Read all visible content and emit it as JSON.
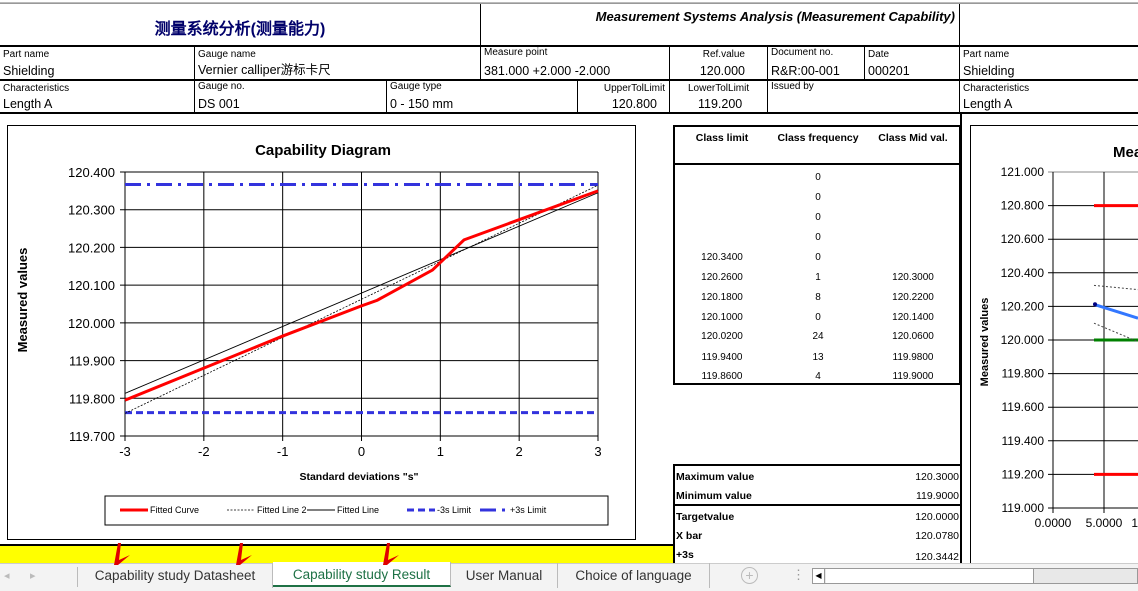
{
  "header": {
    "title_cn": "测量系统分析(测量能力)",
    "title_en": "Measurement Systems Analysis (Measurement Capability)"
  },
  "fields": {
    "part_name": {
      "label": "Part name",
      "value": "Shielding"
    },
    "gauge_name": {
      "label": "Gauge name",
      "value": "Vernier calliper游标卡尺"
    },
    "measure_point": {
      "label": "Measure point",
      "value": "381.000 +2.000 -2.000"
    },
    "ref_value": {
      "label": "Ref.value",
      "value": "120.000"
    },
    "document_no": {
      "label": "Document no.",
      "value": "R&R:00-001"
    },
    "date": {
      "label": "Date",
      "value": "000201"
    },
    "characteristics": {
      "label": "Characteristics",
      "value": "Length A"
    },
    "gauge_no": {
      "label": "Gauge no.",
      "value": "DS 001"
    },
    "gauge_type": {
      "label": "Gauge type",
      "value": "0 - 150 mm"
    },
    "upper_tol": {
      "label": "UpperTolLimit",
      "value": "120.800"
    },
    "lower_tol": {
      "label": "LowerTolLimit",
      "value": "119.200"
    },
    "issued_by": {
      "label": "Issued by",
      "value": ""
    }
  },
  "class_table": {
    "headers": [
      "Class limit",
      "Class frequency",
      "Class Mid val."
    ],
    "rows": [
      [
        "",
        "0",
        ""
      ],
      [
        "",
        "0",
        ""
      ],
      [
        "",
        "0",
        ""
      ],
      [
        "",
        "0",
        ""
      ],
      [
        "120.3400",
        "0",
        ""
      ],
      [
        "120.2600",
        "1",
        "120.3000"
      ],
      [
        "120.1800",
        "8",
        "120.2200"
      ],
      [
        "120.1000",
        "0",
        "120.1400"
      ],
      [
        "120.0200",
        "24",
        "120.0600"
      ],
      [
        "119.9400",
        "13",
        "119.9800"
      ],
      [
        "119.8600",
        "4",
        "119.9000"
      ]
    ]
  },
  "stats": [
    {
      "label": "Maximum value",
      "value": "120.3000"
    },
    {
      "label": "Minimum value",
      "value": "119.9000"
    },
    {
      "label": "Targetvalue",
      "value": "120.0000"
    },
    {
      "label": "X bar",
      "value": "120.0780"
    },
    {
      "label": "+3s",
      "value": "120.3442"
    }
  ],
  "chart_data": [
    {
      "type": "line",
      "title": "Capability Diagram",
      "xlabel": "Standard deviations \"s\"",
      "ylabel": "Measured values",
      "xlim": [
        -3,
        3
      ],
      "ylim": [
        119.7,
        120.4
      ],
      "xticks": [
        "-3",
        "-2",
        "-1",
        "0",
        "1",
        "2",
        "3"
      ],
      "yticks": [
        "120.400",
        "120.300",
        "120.200",
        "120.100",
        "120.000",
        "119.900",
        "119.800",
        "119.700"
      ],
      "legend_position": "bottom",
      "series": [
        {
          "name": "Fitted Curve",
          "color": "#ff0000",
          "points": [
            [
              -3,
              119.795
            ],
            [
              -1,
              119.965
            ],
            [
              0,
              120.045
            ],
            [
              0.2,
              120.06
            ],
            [
              0.9,
              120.14
            ],
            [
              1.3,
              120.22
            ],
            [
              3,
              120.35
            ]
          ]
        },
        {
          "name": "Fitted Line 2",
          "color": "#000000",
          "points": [
            [
              -3,
              119.76
            ],
            [
              3,
              120.365
            ]
          ]
        },
        {
          "name": "Fitted Line",
          "color": "#000000",
          "points": [
            [
              -3,
              119.813
            ],
            [
              3,
              120.345
            ]
          ]
        },
        {
          "name": "-3s Limit",
          "color": "#3333dd",
          "points": [
            [
              -3,
              119.762
            ],
            [
              3,
              119.762
            ]
          ]
        },
        {
          "name": "+3s Limit",
          "color": "#3333dd",
          "points": [
            [
              -3,
              120.367
            ],
            [
              3,
              120.367
            ]
          ]
        }
      ]
    },
    {
      "type": "line",
      "title": "Mea",
      "ylabel": "Measured values",
      "ylim": [
        119.0,
        121.0
      ],
      "yticks": [
        "121.000",
        "120.800",
        "120.600",
        "120.400",
        "120.200",
        "120.000",
        "119.800",
        "119.600",
        "119.400",
        "119.200",
        "119.000"
      ],
      "xticks": [
        "0.0000",
        "5.0000"
      ]
    }
  ],
  "tabs": [
    "Capability study Datasheet",
    "Capability study Result",
    "User Manual",
    "Choice of language"
  ],
  "active_tab": 1
}
